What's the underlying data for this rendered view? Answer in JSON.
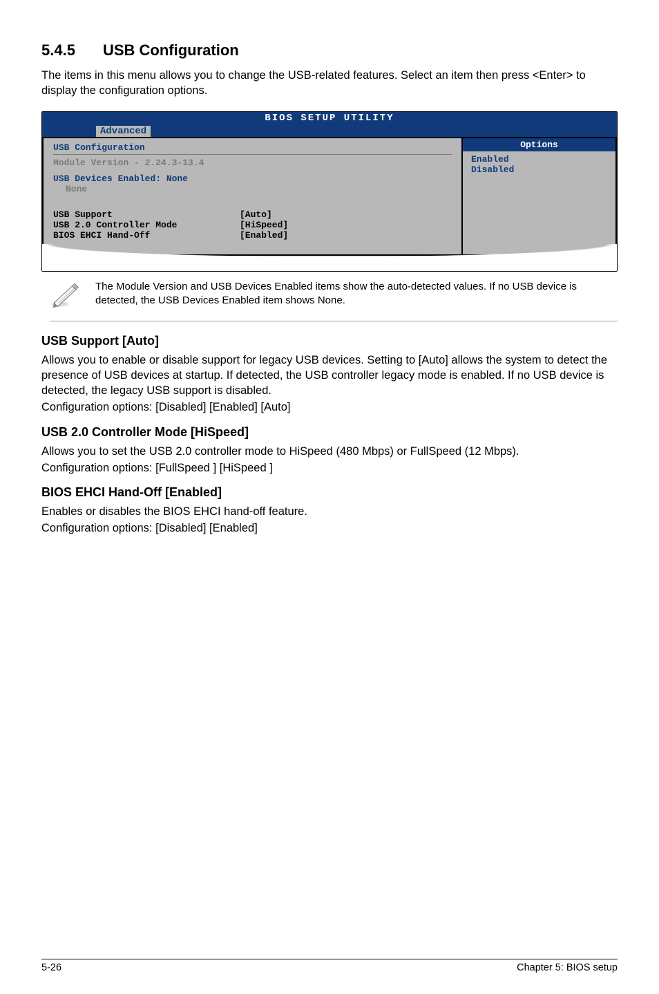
{
  "section": {
    "number": "5.4.5",
    "title": "USB Configuration"
  },
  "intro": "The items in this menu allows you to change the USB-related features. Select an item then press <Enter> to display the configuration options.",
  "bios": {
    "header": "BIOS SETUP UTILITY",
    "tab": "Advanced",
    "left": {
      "title": "USB Configuration",
      "module": "Module Version - 2.24.3-13.4",
      "devLabel": "USB Devices Enabled: None",
      "devNone": "None",
      "items": [
        {
          "label": "USB Support",
          "value": "[Auto]"
        },
        {
          "label": "USB 2.0 Controller Mode",
          "value": "[HiSpeed]"
        },
        {
          "label": "BIOS EHCI Hand-Off",
          "value": "[Enabled]"
        }
      ]
    },
    "right": {
      "header": "Options",
      "opts": [
        "Enabled",
        "Disabled"
      ]
    }
  },
  "note": "The Module Version and USB Devices Enabled items show the auto-detected values. If no USB device is detected, the USB Devices Enabled item shows None.",
  "subs": [
    {
      "title": "USB Support [Auto]",
      "paras": [
        "Allows you to enable or disable support for legacy USB devices. Setting to [Auto] allows the system to detect the presence of USB devices at startup. If detected, the USB controller legacy mode is enabled. If no USB device is detected, the legacy USB support is disabled.",
        "Configuration options: [Disabled] [Enabled] [Auto]"
      ]
    },
    {
      "title": "USB 2.0 Controller Mode [HiSpeed]",
      "paras": [
        "Allows you to set the USB 2.0 controller mode to HiSpeed (480 Mbps) or FullSpeed (12 Mbps).",
        "Configuration options: [FullSpeed ] [HiSpeed ]"
      ]
    },
    {
      "title": "BIOS EHCI Hand-Off [Enabled]",
      "paras": [
        "Enables or disables the BIOS EHCI hand-off feature.",
        "Configuration options: [Disabled] [Enabled]"
      ]
    }
  ],
  "footer": {
    "left": "5-26",
    "right": "Chapter 5: BIOS setup"
  }
}
